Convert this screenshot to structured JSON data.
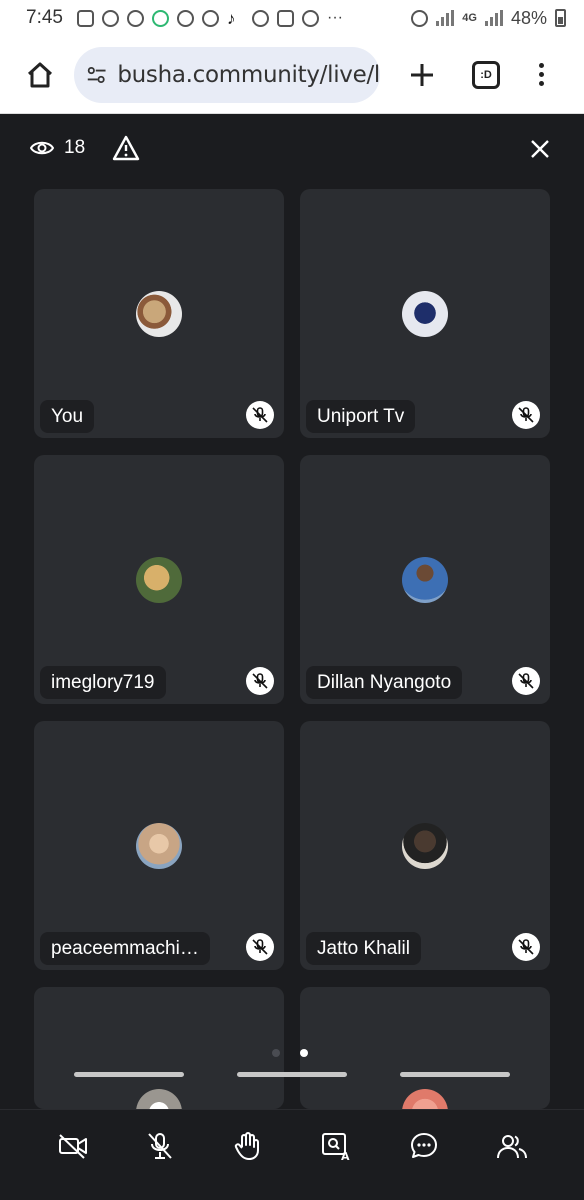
{
  "status_bar": {
    "time": "7:45",
    "network": "4G",
    "battery": "48%"
  },
  "browser": {
    "url": "busha.community/live/l",
    "tab_label": ":D"
  },
  "call": {
    "viewer_count": "18",
    "participants": [
      {
        "name": "You",
        "avatar_color": "#c9a77a",
        "muted": true
      },
      {
        "name": "Uniport Tv",
        "avatar_color": "#e6e8ef",
        "muted": true
      },
      {
        "name": "imeglory719",
        "avatar_color": "#b58a4a",
        "muted": true
      },
      {
        "name": "Dillan Nyangoto",
        "avatar_color": "#3d6fb4",
        "muted": true
      },
      {
        "name": "peaceemmachi…",
        "avatar_color": "#c8a585",
        "muted": true
      },
      {
        "name": "Jatto Khalil",
        "avatar_color": "#4a3a30",
        "muted": true
      },
      {
        "name": "",
        "avatar_color": "#e8e6e2",
        "muted": true
      },
      {
        "name": "",
        "avatar_color": "#e07a6a",
        "muted": true
      }
    ],
    "page_indicator": {
      "total": 2,
      "current": 2
    }
  },
  "toolbar": {
    "icons": [
      "camera-off-icon",
      "mic-off-icon",
      "raise-hand-icon",
      "screen-share-icon",
      "chat-icon",
      "participants-icon"
    ]
  },
  "colors": {
    "background": "#1b1c1f",
    "tile": "#2b2d31",
    "name_tag": "#1e1f22",
    "url_box": "#e8ecf6"
  }
}
